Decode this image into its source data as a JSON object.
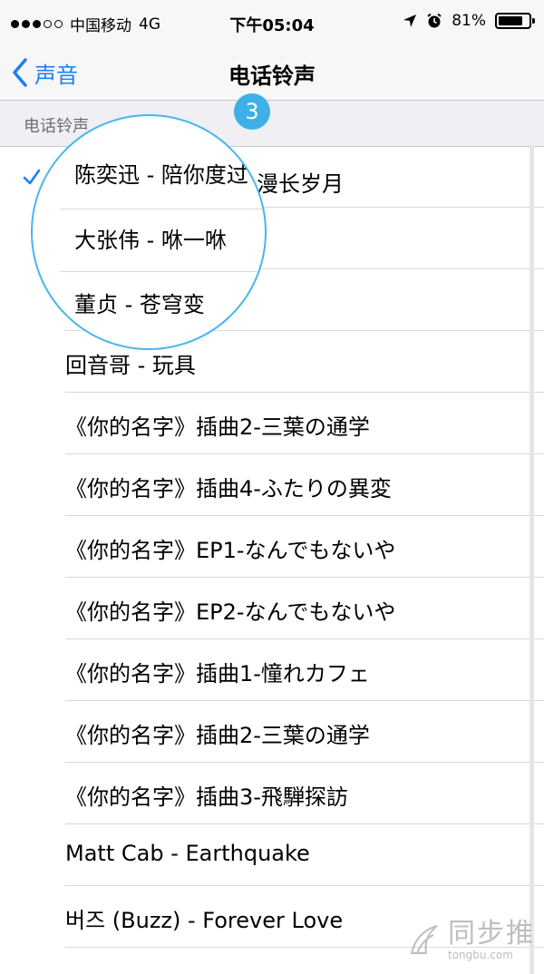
{
  "status_bar": {
    "carrier": "中国移动",
    "network": "4G",
    "time": "下午05:04",
    "battery_percent": "81%",
    "battery_level": 0.81,
    "signal_bars_filled": 3,
    "signal_bars_total": 5
  },
  "nav": {
    "back_label": "声音",
    "title": "电话铃声"
  },
  "section_header": "电话铃声",
  "ringtones": [
    {
      "label": "漫长岁月",
      "selected": true
    },
    {
      "label": "",
      "selected": false
    },
    {
      "label": "",
      "selected": false
    },
    {
      "label": "回音哥 - 玩具",
      "selected": false
    },
    {
      "label": "《你的名字》插曲2-三葉の通学",
      "selected": false
    },
    {
      "label": "《你的名字》插曲4-ふたりの異変",
      "selected": false
    },
    {
      "label": "《你的名字》EP1-なんでもないや",
      "selected": false
    },
    {
      "label": "《你的名字》EP2-なんでもないや",
      "selected": false
    },
    {
      "label": "《你的名字》插曲1-憧れカフェ",
      "selected": false
    },
    {
      "label": "《你的名字》插曲2-三葉の通学",
      "selected": false
    },
    {
      "label": "《你的名字》插曲3-飛騨探訪",
      "selected": false
    },
    {
      "label": "Matt Cab - Earthquake",
      "selected": false
    },
    {
      "label": "버즈 (Buzz) - Forever Love",
      "selected": false
    }
  ],
  "callout": {
    "step_number": "3",
    "items": [
      "陈奕迅 - 陪你度过",
      "大张伟 - 咻一咻",
      "董贞 - 苍穹变"
    ]
  },
  "watermark": {
    "name": "同步推",
    "url": "tongbu.com"
  },
  "colors": {
    "accent": "#1a7ff5",
    "callout": "#3db0ea",
    "bar_bg": "#f7f7f8",
    "section_bg": "#efeff4"
  }
}
